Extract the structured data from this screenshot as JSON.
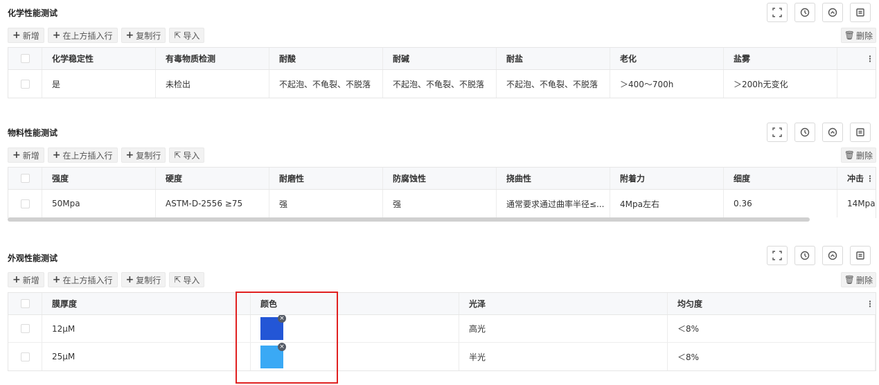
{
  "toolbar": {
    "add": "新增",
    "insert_above": "在上方插入行",
    "copy_row": "复制行",
    "import": "导入",
    "delete": "删除"
  },
  "sections": [
    {
      "title": "化学性能测试",
      "headers": [
        "化学稳定性",
        "有毒物质检测",
        "耐酸",
        "耐碱",
        "耐盐",
        "老化",
        "盐雾"
      ],
      "rows": [
        [
          "是",
          "未检出",
          "不起泡、不龟裂、不脱落",
          "不起泡、不龟裂、不脱落",
          "不起泡、不龟裂、不脱落",
          "＞400～700h",
          "＞200h无变化"
        ]
      ]
    },
    {
      "title": "物料性能测试",
      "headers": [
        "强度",
        "硬度",
        "耐磨性",
        "防腐蚀性",
        "挠曲性",
        "附着力",
        "细度",
        "冲击"
      ],
      "rows": [
        [
          "50Mpa",
          "ASTM-D-2556 ≥75",
          "强",
          "强",
          "通常要求通过曲率半径≤...",
          "4Mpa左右",
          "0.36",
          "14Mpa"
        ]
      ]
    },
    {
      "title": "外观性能测试",
      "headers": [
        "膜厚度",
        "颜色",
        "光泽",
        "均匀度"
      ],
      "rows": [
        {
          "thickness": "12μM",
          "color": "#2356d6",
          "gloss": "高光",
          "uniformity": "＜8%"
        },
        {
          "thickness": "25μM",
          "color": "#3aa9f5",
          "gloss": "半光",
          "uniformity": "＜8%"
        }
      ]
    }
  ],
  "icons": [
    "fullscreen-icon",
    "history-icon",
    "collapse-icon",
    "notes-icon",
    "trash-icon",
    "import-icon",
    "kebab-icon",
    "remove-icon"
  ],
  "accent_colors": {
    "highlight": "#e02020"
  }
}
